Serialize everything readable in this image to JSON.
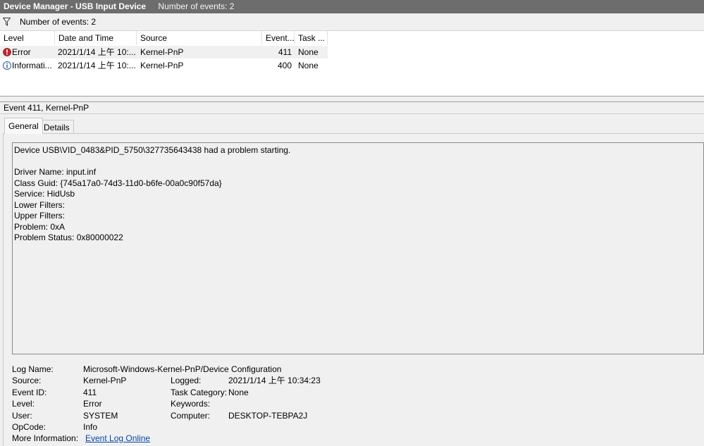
{
  "window": {
    "title": "Device Manager - USB Input Device",
    "subtitle": "Number of events: 2"
  },
  "filter": {
    "icon": "funnel-icon",
    "label": "Number of events: 2"
  },
  "table": {
    "columns": [
      "Level",
      "Date and Time",
      "Source",
      "Event...",
      "Task ..."
    ],
    "rows": [
      {
        "level_icon": "error-icon",
        "level": "Error",
        "datetime": "2021/1/14 上午 10:...",
        "source": "Kernel-PnP",
        "event_id": "411",
        "task": "None",
        "selected": true
      },
      {
        "level_icon": "information-icon",
        "level": "Informati...",
        "datetime": "2021/1/14 上午 10:...",
        "source": "Kernel-PnP",
        "event_id": "400",
        "task": "None",
        "selected": false
      }
    ]
  },
  "event": {
    "header": "Event 411, Kernel-PnP",
    "tabs": [
      "General",
      "Details"
    ],
    "description": [
      "Device USB\\VID_0483&PID_5750\\327735643438 had a problem starting.",
      "",
      "Driver Name: input.inf",
      "Class Guid: {745a17a0-74d3-11d0-b6fe-00a0c90f57da}",
      "Service: HidUsb",
      "Lower Filters:",
      "Upper Filters:",
      "Problem: 0xA",
      "Problem Status: 0x80000022"
    ],
    "props": {
      "log_name_label": "Log Name:",
      "log_name": "Microsoft-Windows-Kernel-PnP/Device Configuration",
      "source_label": "Source:",
      "source": "Kernel-PnP",
      "logged_label": "Logged:",
      "logged": "2021/1/14 上午 10:34:23",
      "event_id_label": "Event ID:",
      "event_id": "411",
      "task_category_label": "Task Category:",
      "task_category": "None",
      "level_label": "Level:",
      "level": "Error",
      "keywords_label": "Keywords:",
      "keywords": "",
      "user_label": "User:",
      "user": "SYSTEM",
      "computer_label": "Computer:",
      "computer": "DESKTOP-TEBPA2J",
      "opcode_label": "OpCode:",
      "opcode": "Info",
      "more_info_label": "More Information:",
      "more_info_link": "Event Log Online "
    }
  },
  "colors": {
    "titlebar": "#6d6d6d",
    "error": "#c4262e",
    "info": "#2a5aa8",
    "link": "#0645ad"
  }
}
